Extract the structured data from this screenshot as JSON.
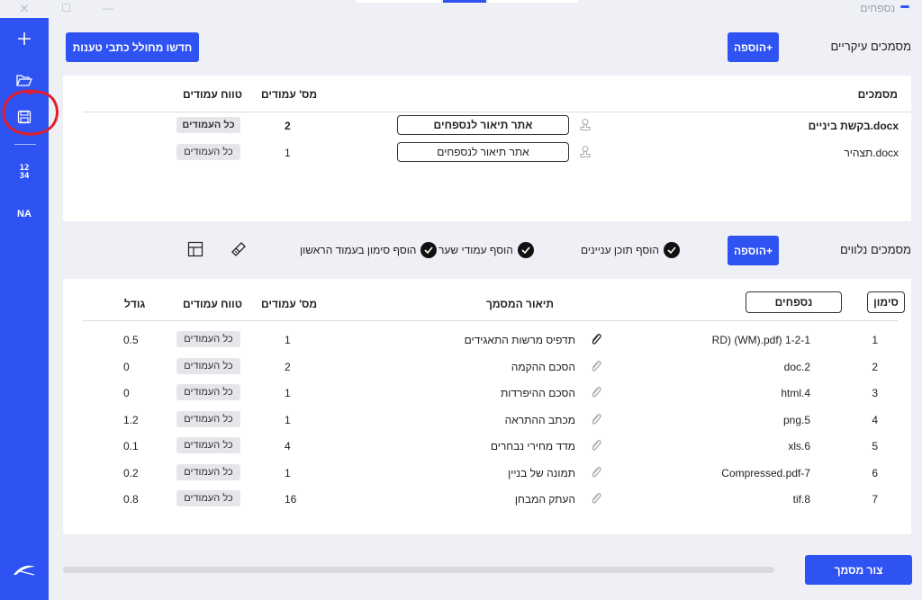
{
  "window": {
    "title": "נספחים",
    "close_glyph": "✕",
    "maximize_glyph": "☐",
    "minimize_glyph": "—"
  },
  "sidebar": {
    "items": [
      {
        "icon": "plus-icon"
      },
      {
        "icon": "folder-open-icon"
      },
      {
        "icon": "save-icon",
        "highlighted": true
      },
      {
        "icon": "numbering-icon",
        "text": "12\n34"
      },
      {
        "icon": "font-size-icon",
        "text": "NA"
      },
      {
        "icon": "signature-icon"
      }
    ]
  },
  "toolbar": {
    "renew_button": "חדשו מחולל כתבי טענות"
  },
  "main_docs": {
    "title": "מסמכים עיקריים",
    "add_button": "הוספה+",
    "headers": {
      "documents": "מסמכים",
      "page_count": "מס' עמודים",
      "page_range": "טווח עמודים"
    },
    "rows": [
      {
        "name": "בקשת ביניים.docx",
        "bold": true,
        "find_button": "אתר תיאור לנספחים",
        "pages": "2",
        "range": "כל העמודים"
      },
      {
        "name": "תצהיר.docx",
        "bold": false,
        "find_button": "אתר תיאור לנספחים",
        "pages": "1",
        "range": "כל העמודים"
      }
    ]
  },
  "attachments": {
    "title": "מסמכים נלווים",
    "add_button": "הוספה+",
    "options": [
      {
        "label": "הוסף תוכן עניינים",
        "checked": true
      },
      {
        "label": "הוסף עמודי שער",
        "checked": true
      },
      {
        "label": "הוסף סימון בעמוד הראשון",
        "checked": true
      }
    ],
    "tool_icons": [
      "brush-icon",
      "table-layout-icon"
    ],
    "headers": {
      "mark": "סימון",
      "appendices": "נספחים",
      "description": "תיאור המסמך",
      "page_count": "מס' עמודים",
      "page_range": "טווח עמודים",
      "size": "גודל"
    },
    "rows": [
      {
        "num": "1",
        "file": "RD) (WM).pdf) 1-2-1",
        "description": "תדפיס מרשות התאגידים",
        "pages": "1",
        "range": "כל העמודים",
        "size": "0.5",
        "clip_dark": true
      },
      {
        "num": "2",
        "file": "doc.2",
        "description": "הסכם ההקמה",
        "pages": "2",
        "range": "כל העמודים",
        "size": "0",
        "clip_dark": false
      },
      {
        "num": "3",
        "file": "html.4",
        "description": "הסכם ההיפרדות",
        "pages": "1",
        "range": "כל העמודים",
        "size": "0",
        "clip_dark": false
      },
      {
        "num": "4",
        "file": "png.5",
        "description": "מכתב ההתראה",
        "pages": "1",
        "range": "כל העמודים",
        "size": "1.2",
        "clip_dark": false
      },
      {
        "num": "5",
        "file": "xls.6",
        "description": "מדד מחירי נבחרים",
        "pages": "4",
        "range": "כל העמודים",
        "size": "0.1",
        "clip_dark": false
      },
      {
        "num": "6",
        "file": "Compressed.pdf-7",
        "description": "תמונה של בניין",
        "pages": "1",
        "range": "כל העמודים",
        "size": "0.2",
        "clip_dark": false
      },
      {
        "num": "7",
        "file": "tif.8",
        "description": "העתק המבחן",
        "pages": "16",
        "range": "כל העמודים",
        "size": "0.8",
        "clip_dark": false
      }
    ]
  },
  "footer": {
    "create_button": "צור מסמך"
  },
  "colors": {
    "accent": "#2f52f2",
    "background": "#eef0f5",
    "annotation": "#e0202a"
  }
}
